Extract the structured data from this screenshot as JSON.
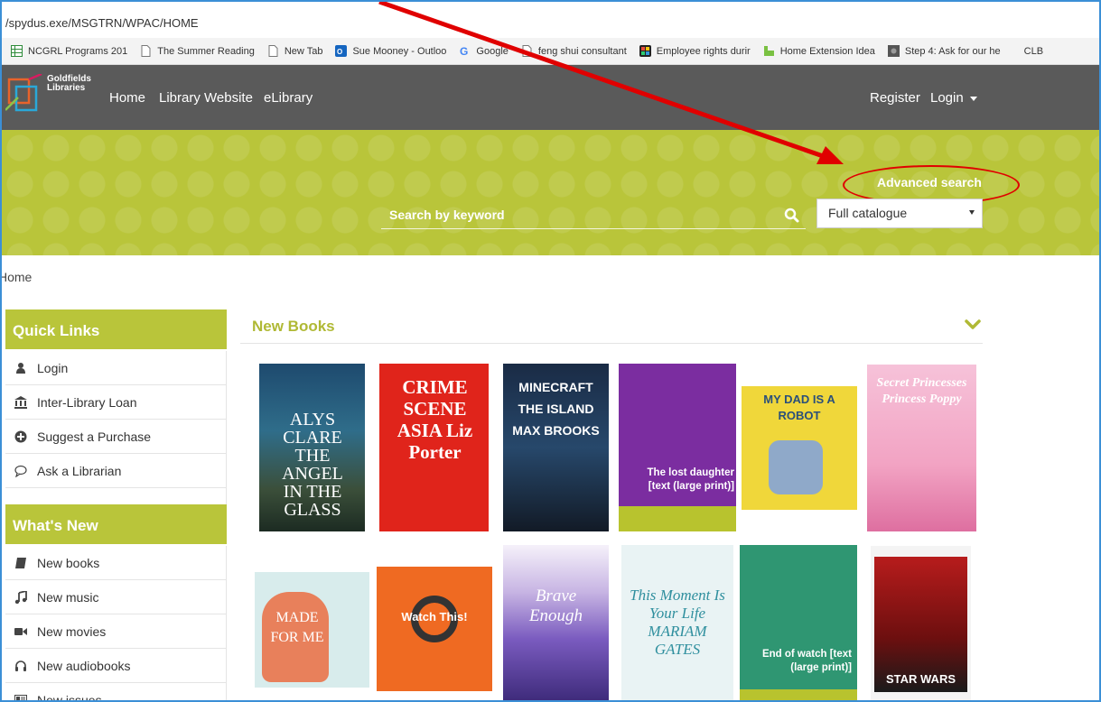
{
  "browser": {
    "url": "/spydus.exe/MSGTRN/WPAC/HOME",
    "bookmarks": [
      {
        "label": "NCGRL Programs 201",
        "icon": "sheet-icon",
        "color": "#2e8b3a"
      },
      {
        "label": "The Summer Reading",
        "icon": "page-icon",
        "color": "#777777"
      },
      {
        "label": "New Tab",
        "icon": "page-icon",
        "color": "#777777"
      },
      {
        "label": "Sue Mooney - Outloo",
        "icon": "outlook-icon",
        "color": "#1565c0"
      },
      {
        "label": "Google",
        "icon": "google-icon",
        "color": "#4285f4"
      },
      {
        "label": "feng shui consultant",
        "icon": "page-icon",
        "color": "#777777"
      },
      {
        "label": "Employee rights durir",
        "icon": "app-icon",
        "color": "#8e44ad"
      },
      {
        "label": "Home Extension Idea",
        "icon": "houzz-icon",
        "color": "#7ac142"
      },
      {
        "label": "Step 4: Ask for our he",
        "icon": "photo-icon",
        "color": "#555555"
      },
      {
        "label": "CLB",
        "icon": "",
        "color": "#777777"
      }
    ]
  },
  "header": {
    "logo_line1": "Goldfields",
    "logo_line2": "Libraries",
    "nav": [
      "Home",
      "Library Website",
      "eLibrary"
    ],
    "register": "Register",
    "login": "Login"
  },
  "search": {
    "advanced_link": "Advanced search",
    "placeholder": "Search by keyword",
    "scope": "Full catalogue"
  },
  "breadcrumb": "Home",
  "sidebar": {
    "quick_links_title": "Quick Links",
    "quick_links": [
      {
        "label": "Login",
        "icon": "user-icon"
      },
      {
        "label": "Inter-Library Loan",
        "icon": "bank-icon"
      },
      {
        "label": "Suggest a Purchase",
        "icon": "plus-circle-icon"
      },
      {
        "label": "Ask a Librarian",
        "icon": "chat-icon"
      }
    ],
    "whats_new_title": "What's New",
    "whats_new": [
      {
        "label": "New books",
        "icon": "book-icon"
      },
      {
        "label": "New music",
        "icon": "music-icon"
      },
      {
        "label": "New movies",
        "icon": "video-icon"
      },
      {
        "label": "New audiobooks",
        "icon": "headphones-icon"
      },
      {
        "label": "New issues",
        "icon": "newspaper-icon"
      }
    ]
  },
  "new_books": {
    "title": "New Books",
    "covers": [
      {
        "title_text": "ALYS CLARE THE ANGEL IN THE GLASS"
      },
      {
        "title_text": "CRIME SCENE ASIA Liz Porter"
      },
      {
        "title_text": "MINECRAFT THE ISLAND MAX BROOKS"
      },
      {
        "title_text": "The lost daughter [text (large print)]"
      },
      {
        "title_text": "MY DAD IS A ROBOT"
      },
      {
        "title_text": "Secret Princesses Princess Poppy"
      },
      {
        "title_text": "MADE FOR ME"
      },
      {
        "title_text": "Watch This!"
      },
      {
        "title_text": "Brave Enough"
      },
      {
        "title_text": "This Moment Is Your Life MARIAM GATES"
      },
      {
        "title_text": "End of watch [text (large print)]"
      },
      {
        "title_text": "STAR WARS"
      }
    ]
  },
  "colors": {
    "accent_green": "#b9c53a",
    "navbar": "#5a5a5a",
    "annotation_red": "#e00000"
  }
}
